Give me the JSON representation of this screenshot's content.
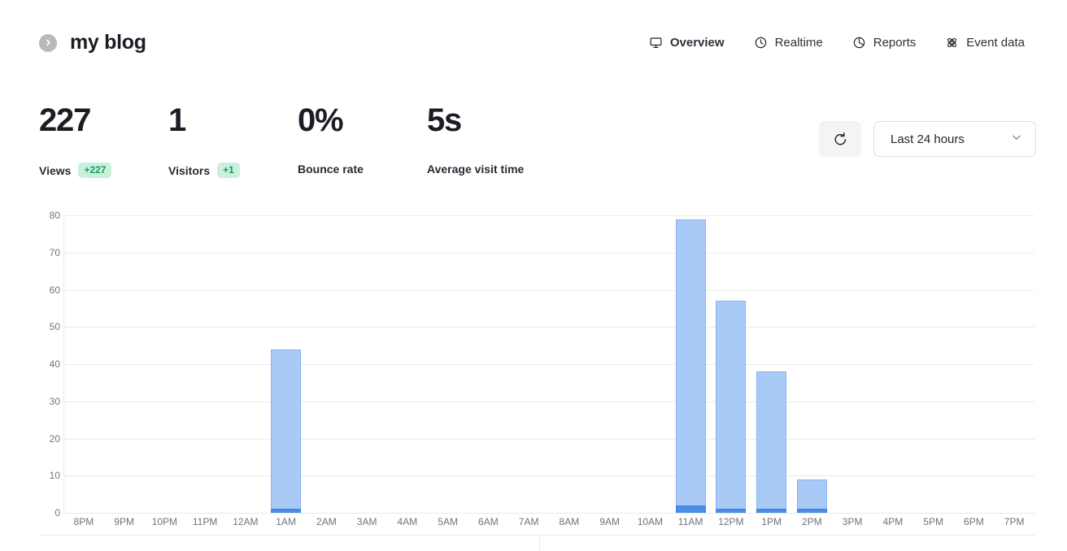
{
  "header": {
    "logo_icon": "chevron-right-circle-icon",
    "website_name": "my blog",
    "nav": [
      {
        "label": "Overview",
        "icon": "monitor-icon",
        "active": true
      },
      {
        "label": "Realtime",
        "icon": "clock-icon",
        "active": false
      },
      {
        "label": "Reports",
        "icon": "pie-chart-icon",
        "active": false
      },
      {
        "label": "Event data",
        "icon": "atom-icon",
        "active": false
      }
    ]
  },
  "metrics": [
    {
      "value": "227",
      "label": "Views",
      "change": "+227"
    },
    {
      "value": "1",
      "label": "Visitors",
      "change": "+1"
    },
    {
      "value": "0%",
      "label": "Bounce rate",
      "change": ""
    },
    {
      "value": "5s",
      "label": "Average visit time",
      "change": ""
    }
  ],
  "controls": {
    "refresh_icon": "refresh-ccw-icon",
    "date_range": "Last 24 hours",
    "chevron_icon": "chevron-down-icon"
  },
  "colors": {
    "views_bar": "#a9caf7",
    "views_bar_border": "#8ab4f0",
    "visitors_bar": "#4a8ee8",
    "badge_bg": "#c9f0dc",
    "badge_text": "#12a05c",
    "gridline": "#e9eaec"
  },
  "chart_data": {
    "type": "bar",
    "title": "",
    "xlabel": "",
    "ylabel": "",
    "ylim": [
      0,
      80
    ],
    "yticks": [
      0,
      10,
      20,
      30,
      40,
      50,
      60,
      70,
      80
    ],
    "grid": true,
    "legend": false,
    "stacked": true,
    "categories": [
      "8PM",
      "9PM",
      "10PM",
      "11PM",
      "12AM",
      "1AM",
      "2AM",
      "3AM",
      "4AM",
      "5AM",
      "6AM",
      "7AM",
      "8AM",
      "9AM",
      "10AM",
      "11AM",
      "12PM",
      "1PM",
      "2PM",
      "3PM",
      "4PM",
      "5PM",
      "6PM",
      "7PM"
    ],
    "series": [
      {
        "name": "Views",
        "color": "#a9caf7",
        "values": [
          0,
          0,
          0,
          0,
          0,
          44,
          0,
          0,
          0,
          0,
          0,
          0,
          0,
          0,
          0,
          79,
          57,
          38,
          9,
          0,
          0,
          0,
          0,
          0
        ]
      },
      {
        "name": "Visitors",
        "color": "#4a8ee8",
        "values": [
          0,
          0,
          0,
          0,
          0,
          1,
          0,
          0,
          0,
          0,
          0,
          0,
          0,
          0,
          0,
          2,
          1,
          1,
          1,
          0,
          0,
          0,
          0,
          0
        ]
      }
    ]
  }
}
